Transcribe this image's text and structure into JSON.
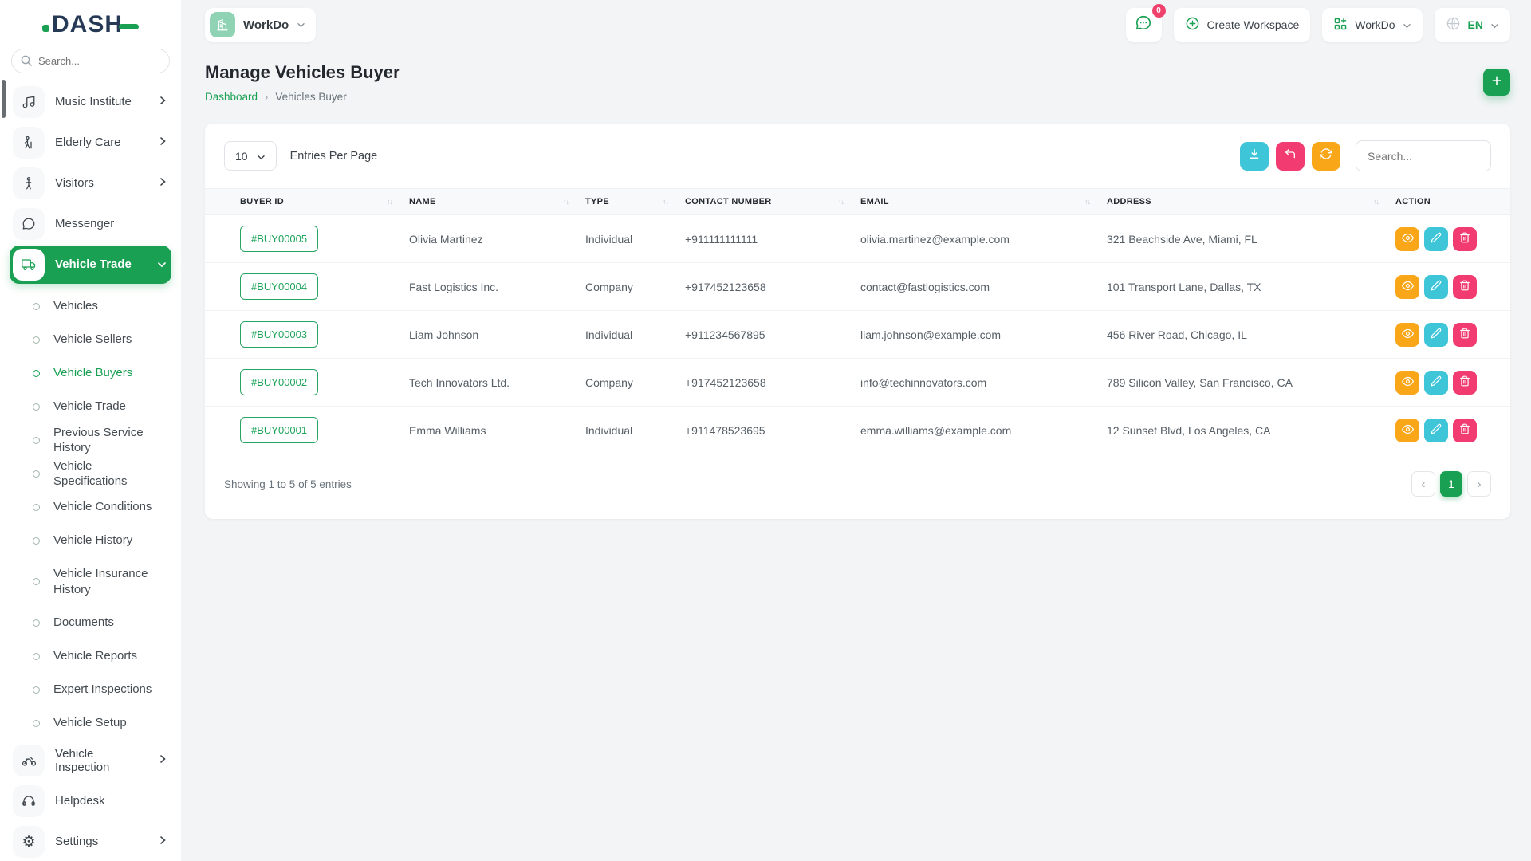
{
  "brand": {
    "name": "DASH"
  },
  "sidebar": {
    "search_placeholder": "Search...",
    "items": [
      {
        "label": "Music Institute",
        "icon": "music-icon"
      },
      {
        "label": "Elderly Care",
        "icon": "elderly-icon"
      },
      {
        "label": "Visitors",
        "icon": "visitor-icon"
      },
      {
        "label": "Messenger",
        "icon": "messenger-icon"
      },
      {
        "label": "Vehicle Trade",
        "icon": "truck-icon",
        "active": true
      }
    ],
    "sub_items": [
      {
        "label": "Vehicles"
      },
      {
        "label": "Vehicle Sellers"
      },
      {
        "label": "Vehicle Buyers",
        "active": true
      },
      {
        "label": "Vehicle Trade"
      },
      {
        "label": "Previous Service History"
      },
      {
        "label": "Vehicle Specifications"
      },
      {
        "label": "Vehicle Conditions"
      },
      {
        "label": "Vehicle History"
      },
      {
        "label": "Vehicle Insurance History"
      },
      {
        "label": "Documents"
      },
      {
        "label": "Vehicle Reports"
      },
      {
        "label": "Expert Inspections"
      },
      {
        "label": "Vehicle Setup"
      }
    ],
    "bottom_items": [
      {
        "label": "Vehicle Inspection",
        "icon": "motorcycle-icon"
      },
      {
        "label": "Helpdesk",
        "icon": "headset-icon"
      },
      {
        "label": "Settings",
        "icon": "gear-icon"
      }
    ]
  },
  "topbar": {
    "workspace_label": "WorkDo",
    "messages_badge": "0",
    "create_workspace_label": "Create Workspace",
    "workdo_menu_label": "WorkDo",
    "language_label": "EN"
  },
  "page": {
    "title": "Manage Vehicles Buyer",
    "breadcrumb_home": "Dashboard",
    "breadcrumb_separator": "›",
    "breadcrumb_current": "Vehicles Buyer"
  },
  "table": {
    "entries_per_page_value": "10",
    "entries_per_page_label": "Entries Per Page",
    "search_placeholder": "Search...",
    "sort_glyph": "↑↓",
    "columns": [
      "BUYER ID",
      "NAME",
      "TYPE",
      "CONTACT NUMBER",
      "EMAIL",
      "ADDRESS",
      "ACTION"
    ],
    "rows": [
      {
        "id": "#BUY00005",
        "name": "Olivia Martinez",
        "type": "Individual",
        "contact": "+911111111111",
        "email": "olivia.martinez@example.com",
        "address": "321 Beachside Ave, Miami, FL"
      },
      {
        "id": "#BUY00004",
        "name": "Fast Logistics Inc.",
        "type": "Company",
        "contact": "+917452123658",
        "email": "contact@fastlogistics.com",
        "address": "101 Transport Lane, Dallas, TX"
      },
      {
        "id": "#BUY00003",
        "name": "Liam Johnson",
        "type": "Individual",
        "contact": "+911234567895",
        "email": "liam.johnson@example.com",
        "address": "456 River Road, Chicago, IL"
      },
      {
        "id": "#BUY00002",
        "name": "Tech Innovators Ltd.",
        "type": "Company",
        "contact": "+917452123658",
        "email": "info@techinnovators.com",
        "address": "789 Silicon Valley, San Francisco, CA"
      },
      {
        "id": "#BUY00001",
        "name": "Emma Williams",
        "type": "Individual",
        "contact": "+911478523695",
        "email": "emma.williams@example.com",
        "address": "12 Sunset Blvd, Los Angeles, CA"
      }
    ],
    "footer_text": "Showing 1 to 5 of 5 entries",
    "pagination": {
      "prev": "‹",
      "current": "1",
      "next": "›"
    }
  },
  "icons": {
    "add": "plus-icon",
    "export": "download-icon",
    "undo": "arrow-back-icon",
    "refresh": "refresh-icon",
    "view": "eye-icon",
    "edit": "pencil-icon",
    "delete": "trash-icon"
  },
  "colors": {
    "primary_green": "#1aa053",
    "info_cyan": "#3ec6d8",
    "danger_pink": "#f23b70",
    "warning_orange": "#f9a619",
    "badge_red": "#f0416c"
  }
}
